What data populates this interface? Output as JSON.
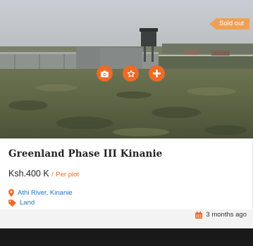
{
  "listing": {
    "badge": "Sold out",
    "title": "Greenland Phase III Kinanie",
    "price": "Ksh.400 K",
    "price_separator": "/",
    "price_unit": "Per plot",
    "location": "Athi River, Kinanie",
    "property_type": "Land",
    "posted": "3 months ago"
  },
  "actions": [
    {
      "icon": "camera-icon"
    },
    {
      "icon": "star-icon"
    },
    {
      "icon": "plus-icon"
    }
  ],
  "colors": {
    "accent": "#ef6a26",
    "badge": "#f0a055",
    "link": "#1f73c4",
    "footer": "#191919"
  }
}
